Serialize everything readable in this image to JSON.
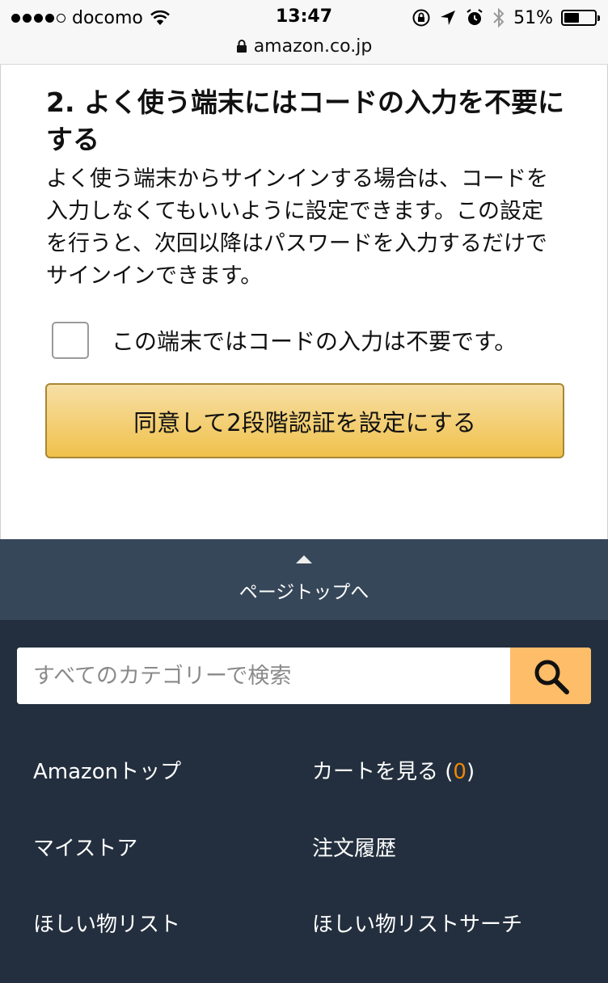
{
  "status_bar": {
    "carrier": "docomo",
    "time": "13:47",
    "battery_percent": "51%",
    "battery_level": 0.51,
    "url": "amazon.co.jp"
  },
  "content": {
    "heading": "2. よく使う端末にはコードの入力を不要にする",
    "body": "よく使う端末からサインインする場合は、コードを入力しなくてもいいように設定できます。この設定を行うと、次回以降はパスワードを入力するだけでサインインできます。",
    "checkbox_label": "この端末ではコードの入力は不要です。",
    "checkbox_checked": false,
    "primary_button": "同意して2段階認証を設定にする"
  },
  "back_to_top": {
    "label": "ページトップへ"
  },
  "footer": {
    "search_placeholder": "すべてのカテゴリーで検索",
    "links": {
      "amazon_top": "Amazonトップ",
      "cart_prefix": "カートを見る (",
      "cart_count": "0",
      "cart_suffix": ")",
      "my_store": "マイストア",
      "order_history": "注文履歴",
      "wishlist": "ほしい物リスト",
      "wishlist_search": "ほしい物リストサーチ"
    }
  },
  "colors": {
    "footer_bg": "#232f3e",
    "back_to_top_bg": "#37475a",
    "button_gradient_top": "#f7dfa5",
    "button_gradient_bottom": "#f0c14b",
    "search_button": "#febd69",
    "cart_count": "#f08804"
  }
}
